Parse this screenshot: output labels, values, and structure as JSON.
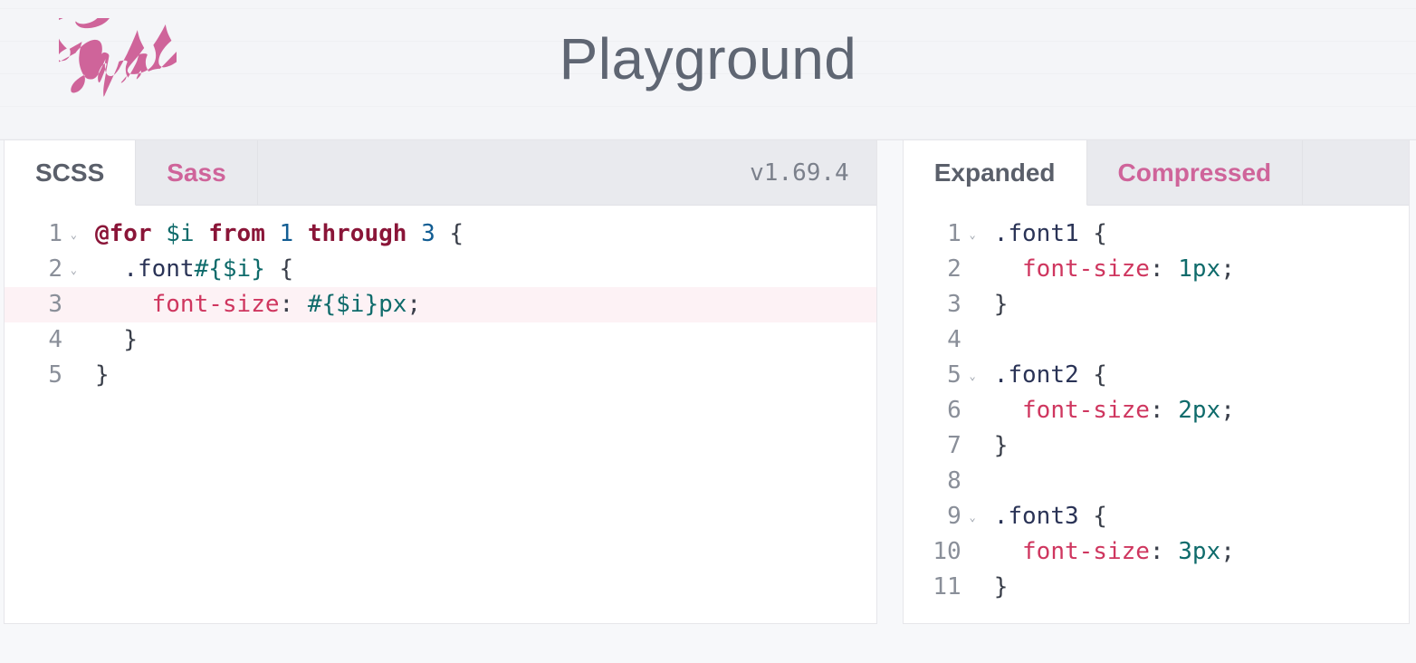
{
  "header": {
    "title": "Playground",
    "logo_alt": "Sass"
  },
  "left_pane": {
    "tabs": [
      {
        "label": "SCSS",
        "active": true
      },
      {
        "label": "Sass",
        "active": false
      }
    ],
    "version": "v1.69.4",
    "code": {
      "active_line": 3,
      "lines": [
        {
          "n": "1",
          "fold": true,
          "tokens": [
            {
              "cls": "tok-kw",
              "text": "@for"
            },
            {
              "cls": "tok-plain",
              "text": " "
            },
            {
              "cls": "tok-var",
              "text": "$i"
            },
            {
              "cls": "tok-plain",
              "text": " "
            },
            {
              "cls": "tok-kw",
              "text": "from"
            },
            {
              "cls": "tok-plain",
              "text": " "
            },
            {
              "cls": "tok-num",
              "text": "1"
            },
            {
              "cls": "tok-plain",
              "text": " "
            },
            {
              "cls": "tok-kw",
              "text": "through"
            },
            {
              "cls": "tok-plain",
              "text": " "
            },
            {
              "cls": "tok-num",
              "text": "3"
            },
            {
              "cls": "tok-plain",
              "text": " "
            },
            {
              "cls": "tok-punc",
              "text": "{"
            }
          ]
        },
        {
          "n": "2",
          "fold": true,
          "tokens": [
            {
              "cls": "tok-plain",
              "text": "  "
            },
            {
              "cls": "tok-sel",
              "text": ".font"
            },
            {
              "cls": "tok-interp",
              "text": "#{$i}"
            },
            {
              "cls": "tok-plain",
              "text": " "
            },
            {
              "cls": "tok-punc",
              "text": "{"
            }
          ]
        },
        {
          "n": "3",
          "fold": false,
          "tokens": [
            {
              "cls": "tok-plain",
              "text": "    "
            },
            {
              "cls": "tok-prop",
              "text": "font-size"
            },
            {
              "cls": "tok-punc",
              "text": ": "
            },
            {
              "cls": "tok-interp",
              "text": "#{$i}"
            },
            {
              "cls": "tok-val",
              "text": "px"
            },
            {
              "cls": "tok-punc",
              "text": ";"
            }
          ]
        },
        {
          "n": "4",
          "fold": false,
          "tokens": [
            {
              "cls": "tok-plain",
              "text": "  "
            },
            {
              "cls": "tok-punc",
              "text": "}"
            }
          ]
        },
        {
          "n": "5",
          "fold": false,
          "tokens": [
            {
              "cls": "tok-punc",
              "text": "}"
            }
          ]
        }
      ]
    }
  },
  "right_pane": {
    "tabs": [
      {
        "label": "Expanded",
        "active": true
      },
      {
        "label": "Compressed",
        "active": false
      }
    ],
    "code": {
      "active_line": 0,
      "lines": [
        {
          "n": "1",
          "fold": true,
          "tokens": [
            {
              "cls": "tok-sel",
              "text": ".font1"
            },
            {
              "cls": "tok-plain",
              "text": " "
            },
            {
              "cls": "tok-punc",
              "text": "{"
            }
          ]
        },
        {
          "n": "2",
          "fold": false,
          "tokens": [
            {
              "cls": "tok-plain",
              "text": "  "
            },
            {
              "cls": "tok-prop",
              "text": "font-size"
            },
            {
              "cls": "tok-punc",
              "text": ": "
            },
            {
              "cls": "tok-val",
              "text": "1px"
            },
            {
              "cls": "tok-punc",
              "text": ";"
            }
          ]
        },
        {
          "n": "3",
          "fold": false,
          "tokens": [
            {
              "cls": "tok-punc",
              "text": "}"
            }
          ]
        },
        {
          "n": "4",
          "fold": false,
          "tokens": [
            {
              "cls": "tok-plain",
              "text": " "
            }
          ]
        },
        {
          "n": "5",
          "fold": true,
          "tokens": [
            {
              "cls": "tok-sel",
              "text": ".font2"
            },
            {
              "cls": "tok-plain",
              "text": " "
            },
            {
              "cls": "tok-punc",
              "text": "{"
            }
          ]
        },
        {
          "n": "6",
          "fold": false,
          "tokens": [
            {
              "cls": "tok-plain",
              "text": "  "
            },
            {
              "cls": "tok-prop",
              "text": "font-size"
            },
            {
              "cls": "tok-punc",
              "text": ": "
            },
            {
              "cls": "tok-val",
              "text": "2px"
            },
            {
              "cls": "tok-punc",
              "text": ";"
            }
          ]
        },
        {
          "n": "7",
          "fold": false,
          "tokens": [
            {
              "cls": "tok-punc",
              "text": "}"
            }
          ]
        },
        {
          "n": "8",
          "fold": false,
          "tokens": [
            {
              "cls": "tok-plain",
              "text": " "
            }
          ]
        },
        {
          "n": "9",
          "fold": true,
          "tokens": [
            {
              "cls": "tok-sel",
              "text": ".font3"
            },
            {
              "cls": "tok-plain",
              "text": " "
            },
            {
              "cls": "tok-punc",
              "text": "{"
            }
          ]
        },
        {
          "n": "10",
          "fold": false,
          "tokens": [
            {
              "cls": "tok-plain",
              "text": "  "
            },
            {
              "cls": "tok-prop",
              "text": "font-size"
            },
            {
              "cls": "tok-punc",
              "text": ": "
            },
            {
              "cls": "tok-val",
              "text": "3px"
            },
            {
              "cls": "tok-punc",
              "text": ";"
            }
          ]
        },
        {
          "n": "11",
          "fold": false,
          "tokens": [
            {
              "cls": "tok-punc",
              "text": "}"
            }
          ]
        }
      ]
    }
  }
}
